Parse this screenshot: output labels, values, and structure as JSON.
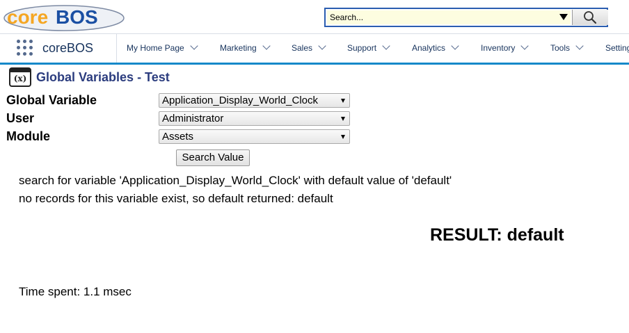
{
  "header": {
    "logo_text": "coreBOS",
    "search": {
      "value": "Search..."
    }
  },
  "navbar": {
    "brand": "coreBOS",
    "items": [
      "My Home Page",
      "Marketing",
      "Sales",
      "Support",
      "Analytics",
      "Inventory",
      "Tools",
      "Settings"
    ]
  },
  "page": {
    "title": "Global Variables - Test",
    "icon_text": "(x)"
  },
  "form": {
    "global_variable": {
      "label": "Global Variable",
      "value": "Application_Display_World_Clock"
    },
    "user": {
      "label": "User",
      "value": "Administrator"
    },
    "module": {
      "label": "Module",
      "value": "Assets"
    },
    "search_button": "Search Value"
  },
  "output": {
    "line1": "search for variable 'Application_Display_World_Clock' with default value of 'default'",
    "line2": "no records for this variable exist, so default returned: default",
    "result": "RESULT: default",
    "time": "Time spent: 1.1 msec"
  },
  "colors": {
    "accent": "#1589c9",
    "title": "#2b3c7e",
    "logo_orange": "#f5a623",
    "logo_blue": "#1a4fa3"
  }
}
